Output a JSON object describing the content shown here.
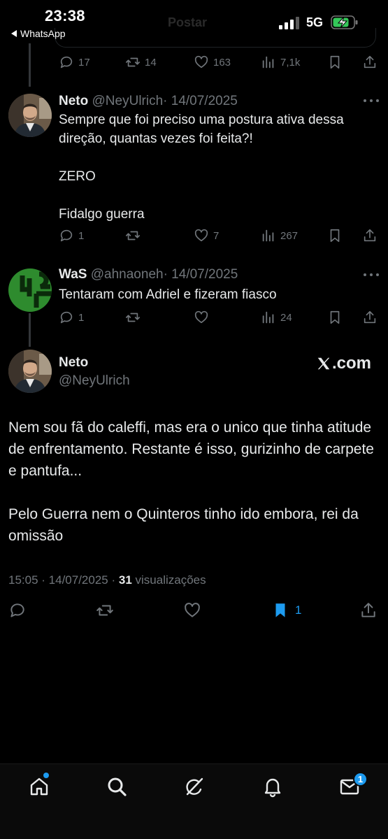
{
  "status_bar": {
    "time": "23:38",
    "back_app": "WhatsApp",
    "network": "5G",
    "ghost_title": "Postar"
  },
  "previous_tweet": {
    "replies": "17",
    "reposts": "14",
    "likes": "163",
    "views": "7,1k"
  },
  "replies": [
    {
      "name": "Neto",
      "handle": "@NeyUlrich",
      "date": "· 14/07/2025",
      "text": "Sempre que foi preciso uma postura ativa dessa direção, quantas vezes foi feita?!\n\nZERO\n\nFidalgo guerra",
      "replies": "1",
      "reposts": "",
      "likes": "7",
      "views": "267"
    },
    {
      "name": "WaS",
      "handle": "@ahnaoneh",
      "date": "· 14/07/2025",
      "text": "Tentaram com Adriel e fizeram fiasco",
      "replies": "1",
      "reposts": "",
      "likes": "",
      "views": "24"
    }
  ],
  "main_tweet": {
    "name": "Neto",
    "handle": "@NeyUlrich",
    "source": ".com",
    "text": "Nem sou fã do caleffi, mas era o unico que tinha atitude de enfrentamento. Restante é isso, gurizinho de carpete e pantufa...\n\nPelo Guerra nem o Quinteros tinho ido embora, rei da omissão",
    "time": "15:05",
    "date": "· 14/07/2025 ·",
    "views_count": "31",
    "views_label": "visualizações",
    "bookmarks": "1"
  },
  "nav": {
    "messages_badge": "1",
    "accent": "#1d9bf0"
  }
}
